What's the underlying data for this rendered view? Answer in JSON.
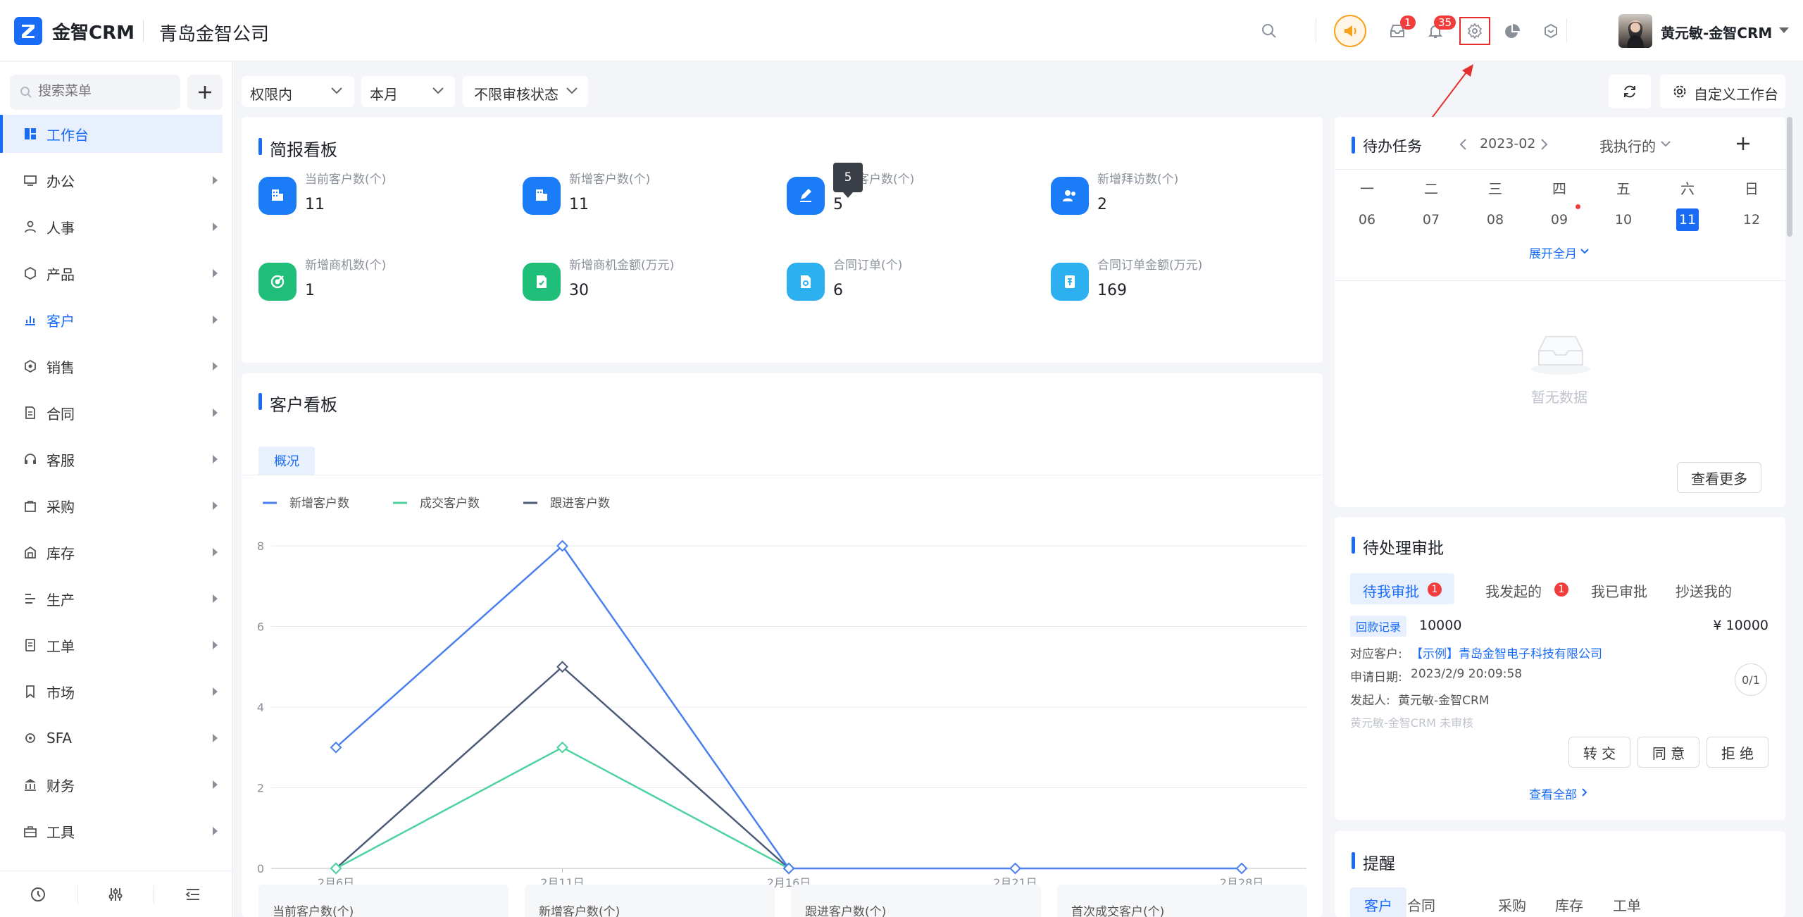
{
  "header": {
    "brand": "金智CRM",
    "company": "青岛金智公司",
    "badge_mail": "1",
    "badge_bell": "35",
    "user_name": "黄元敏-金智CRM"
  },
  "sidebar": {
    "search_placeholder": "搜索菜单",
    "items": [
      {
        "label": "工作台",
        "icon": "dashboard-icon"
      },
      {
        "label": "办公",
        "icon": "office-icon"
      },
      {
        "label": "人事",
        "icon": "people-icon"
      },
      {
        "label": "产品",
        "icon": "cube-icon"
      },
      {
        "label": "客户",
        "icon": "chart-icon"
      },
      {
        "label": "销售",
        "icon": "sales-icon"
      },
      {
        "label": "合同",
        "icon": "contract-icon"
      },
      {
        "label": "客服",
        "icon": "headset-icon"
      },
      {
        "label": "采购",
        "icon": "bag-icon"
      },
      {
        "label": "库存",
        "icon": "warehouse-icon"
      },
      {
        "label": "生产",
        "icon": "production-icon"
      },
      {
        "label": "工单",
        "icon": "ticket-icon"
      },
      {
        "label": "市场",
        "icon": "bookmark-icon"
      },
      {
        "label": "SFA",
        "icon": "gear-icon"
      },
      {
        "label": "财务",
        "icon": "bank-icon"
      },
      {
        "label": "工具",
        "icon": "toolbox-icon"
      }
    ]
  },
  "filters": {
    "scope": "权限内",
    "period": "本月",
    "audit": "不限审核状态"
  },
  "toolbar": {
    "customize": "自定义工作台"
  },
  "briefing": {
    "title": "简报看板",
    "tooltip": "5",
    "stats": [
      {
        "label": "当前客户数(个)",
        "value": "11",
        "color": "#1a7cf6"
      },
      {
        "label": "新增客户数(个)",
        "value": "11",
        "color": "#1a7cf6"
      },
      {
        "label": "跟进客户数(个)",
        "value": "5",
        "color": "#1a7cf6"
      },
      {
        "label": "新增拜访数(个)",
        "value": "2",
        "color": "#1a7cf6"
      },
      {
        "label": "新增商机数(个)",
        "value": "1",
        "color": "#1fbf7a"
      },
      {
        "label": "新增商机金额(万元)",
        "value": "30",
        "color": "#1fbf7a"
      },
      {
        "label": "合同订单(个)",
        "value": "6",
        "color": "#2db0f0"
      },
      {
        "label": "合同订单金额(万元)",
        "value": "169",
        "color": "#2db0f0"
      }
    ]
  },
  "customer_board": {
    "title": "客户看板",
    "tab": "概况",
    "bottom_cards": [
      "当前客户数(个)",
      "新增客户数(个)",
      "跟进客户数(个)",
      "首次成交客户(个)"
    ]
  },
  "chart_data": {
    "type": "line",
    "categories": [
      "2月6日",
      "2月11日",
      "2月16日",
      "2月21日",
      "2月28日"
    ],
    "ylim": [
      0,
      8
    ],
    "yticks": [
      "0",
      "2",
      "4",
      "6",
      "8"
    ],
    "grid": true,
    "legend_position": "top-left",
    "series": [
      {
        "name": "新增客户数",
        "values": [
          3,
          8,
          0,
          0,
          0
        ],
        "color": "#4a7ff0"
      },
      {
        "name": "成交客户数",
        "values": [
          0,
          3,
          0,
          null,
          null
        ],
        "color": "#4ed3a0"
      },
      {
        "name": "跟进客户数",
        "values": [
          0,
          5,
          0,
          null,
          null
        ],
        "color": "#4b5a78"
      }
    ]
  },
  "tasks": {
    "title": "待办任务",
    "month": "2023-02",
    "filter": "我执行的",
    "weekdays": [
      "一",
      "二",
      "三",
      "四",
      "五",
      "六",
      "日"
    ],
    "dates": [
      "06",
      "07",
      "08",
      "09",
      "10",
      "11",
      "12"
    ],
    "expand": "展开全月",
    "empty": "暂无数据",
    "more": "查看更多"
  },
  "approval": {
    "title": "待处理审批",
    "tabs": [
      "待我审批",
      "我发起的",
      "我已审批",
      "抄送我的"
    ],
    "badge1": "1",
    "badge2": "1",
    "tag": "回款记录",
    "amount": "10000",
    "amount_right": "¥ 10000",
    "customer_label": "对应客户:",
    "customer_value": "【示例】青岛金智电子科技有限公司",
    "date_label": "申请日期:",
    "date_value": "2023/2/9 20:09:58",
    "initiator_label": "发起人:",
    "initiator_value": "黄元敏-金智CRM",
    "status": "黄元敏-金智CRM 未审核",
    "progress": "0/1",
    "btn_transfer": "转 交",
    "btn_agree": "同 意",
    "btn_reject": "拒 绝",
    "view_all": "查看全部"
  },
  "reminder": {
    "title": "提醒",
    "tabs": [
      "客户",
      "合同",
      "采购",
      "库存",
      "工单"
    ]
  }
}
